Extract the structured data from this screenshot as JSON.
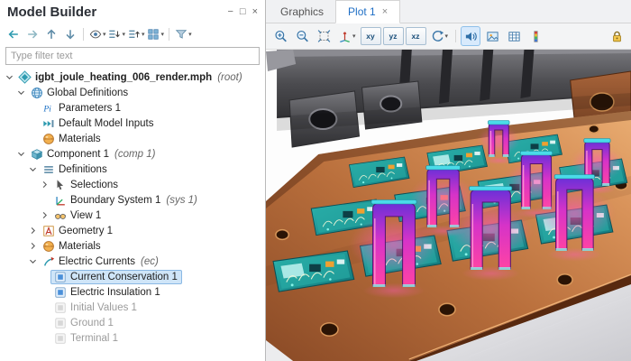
{
  "model_builder": {
    "title": "Model Builder",
    "filter_placeholder": "Type filter text",
    "window_controls": [
      {
        "name": "minimize",
        "glyph": "−"
      },
      {
        "name": "float",
        "glyph": "□"
      },
      {
        "name": "close",
        "glyph": "×"
      }
    ],
    "toolbar": [
      {
        "name": "back",
        "icon": "arrow-left"
      },
      {
        "name": "forward",
        "icon": "arrow-right"
      },
      {
        "name": "move-up",
        "icon": "arrow-up"
      },
      {
        "name": "move-down",
        "icon": "arrow-down"
      },
      {
        "type": "sep"
      },
      {
        "name": "show",
        "icon": "eye",
        "caret": true
      },
      {
        "name": "expand-all",
        "icon": "list-expand",
        "caret": true
      },
      {
        "name": "collapse-all",
        "icon": "list-collapse",
        "caret": true
      },
      {
        "name": "model-tree-nodes",
        "icon": "grid",
        "caret": true
      },
      {
        "type": "sep"
      },
      {
        "name": "filter",
        "icon": "funnel",
        "caret": true
      }
    ],
    "tree": [
      {
        "level": 0,
        "expander": "expanded",
        "icon": "model",
        "label": "igbt_joule_heating_006_render.mph",
        "suffix": "(root)",
        "bold": true
      },
      {
        "level": 1,
        "expander": "expanded",
        "icon": "globe",
        "label": "Global Definitions"
      },
      {
        "level": 2,
        "expander": "none",
        "icon": "parameters",
        "label": "Parameters 1"
      },
      {
        "level": 2,
        "expander": "none",
        "icon": "model-inputs",
        "label": "Default Model Inputs"
      },
      {
        "level": 2,
        "expander": "none",
        "icon": "materials",
        "label": "Materials"
      },
      {
        "level": 1,
        "expander": "expanded",
        "icon": "component",
        "label": "Component 1",
        "suffix": "(comp 1)"
      },
      {
        "level": 2,
        "expander": "expanded",
        "icon": "definitions",
        "label": "Definitions"
      },
      {
        "level": 3,
        "expander": "collapsed",
        "icon": "selections",
        "label": "Selections"
      },
      {
        "level": 3,
        "expander": "none",
        "icon": "boundary-system",
        "label": "Boundary System 1",
        "suffix": "(sys 1)"
      },
      {
        "level": 3,
        "expander": "collapsed",
        "icon": "view",
        "label": "View 1"
      },
      {
        "level": 2,
        "expander": "collapsed",
        "icon": "geometry",
        "label": "Geometry 1"
      },
      {
        "level": 2,
        "expander": "collapsed",
        "icon": "materials",
        "label": "Materials"
      },
      {
        "level": 2,
        "expander": "expanded",
        "icon": "electric-currents",
        "label": "Electric Currents",
        "suffix": "(ec)"
      },
      {
        "level": 3,
        "expander": "none",
        "icon": "feature",
        "label": "Current Conservation 1",
        "selected": true
      },
      {
        "level": 3,
        "expander": "none",
        "icon": "feature",
        "label": "Electric Insulation 1"
      },
      {
        "level": 3,
        "expander": "none",
        "icon": "feature-off",
        "label": "Initial Values 1",
        "disabled": true
      },
      {
        "level": 3,
        "expander": "none",
        "icon": "feature-off",
        "label": "Ground 1",
        "disabled": true
      },
      {
        "level": 3,
        "expander": "none",
        "icon": "feature-off",
        "label": "Terminal 1",
        "disabled": true
      }
    ]
  },
  "graphics": {
    "tabs": [
      {
        "label": "Graphics",
        "active": false,
        "closable": false
      },
      {
        "label": "Plot 1",
        "active": true,
        "closable": true
      }
    ],
    "close_glyph": "×",
    "toolbar": [
      {
        "name": "zoom-in",
        "icon": "zoom-in"
      },
      {
        "name": "zoom-out",
        "icon": "zoom-out"
      },
      {
        "name": "zoom-extents",
        "icon": "zoom-extents"
      },
      {
        "name": "default-view",
        "icon": "axis-3d",
        "caret": true
      },
      {
        "name": "view-xy",
        "type": "plane",
        "label": "xy"
      },
      {
        "name": "view-yz",
        "type": "plane",
        "label": "yz"
      },
      {
        "name": "view-xz",
        "type": "plane",
        "label": "xz"
      },
      {
        "name": "rotate-view",
        "icon": "rotate",
        "caret": true
      },
      {
        "type": "sep"
      },
      {
        "name": "sound",
        "icon": "speaker",
        "active": true
      },
      {
        "name": "scene-image",
        "icon": "image"
      },
      {
        "name": "table-grid",
        "icon": "grid-table"
      },
      {
        "name": "color-legend",
        "icon": "legend"
      },
      {
        "type": "spacer"
      },
      {
        "name": "lock",
        "icon": "lock"
      }
    ],
    "render_colors": {
      "copper": "#b96f3c",
      "board_teal": "#1f9d9a",
      "glow_magenta": "#ff43a4",
      "busbar_gray": "#4b4b4f",
      "cap_cyan": "#4adbe8"
    }
  }
}
